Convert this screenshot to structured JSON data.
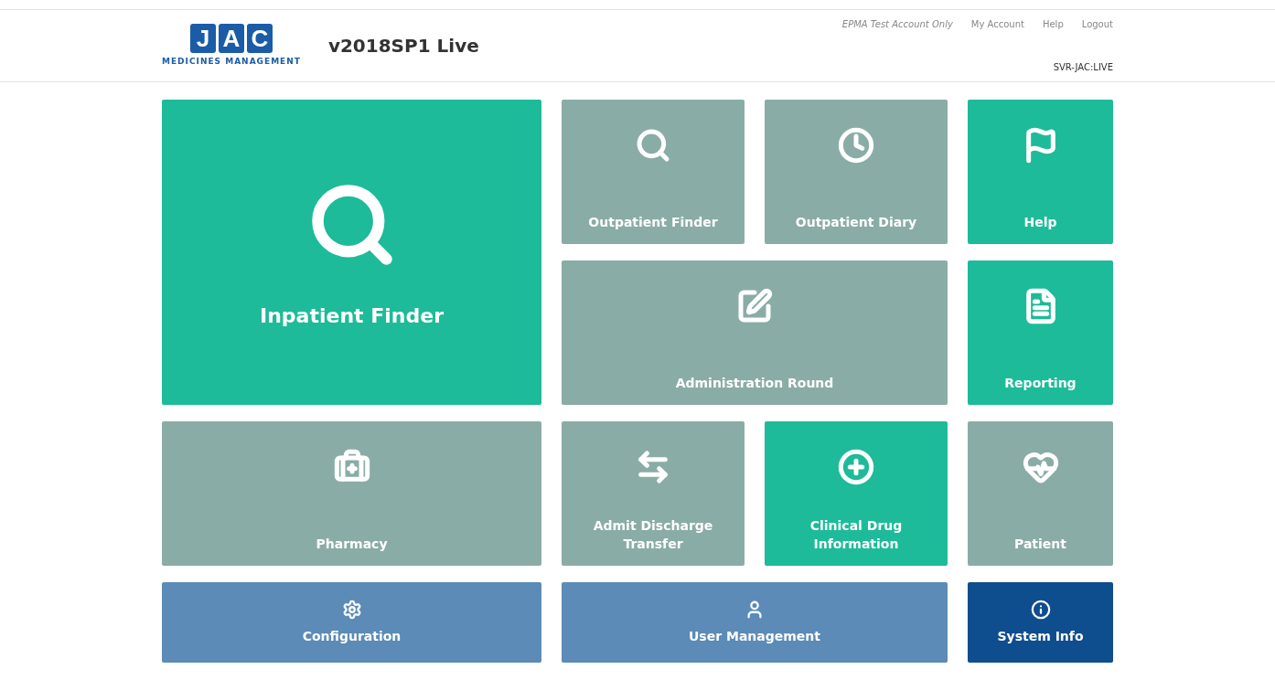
{
  "header": {
    "logo_letters": [
      "J",
      "A",
      "C"
    ],
    "logo_tagline": "MEDICINES MANAGEMENT",
    "version": "v2018SP1 Live",
    "account_note": "EPMA Test Account Only",
    "links": [
      "My Account",
      "Help",
      "Logout"
    ],
    "server": "SVR-JAC:LIVE"
  },
  "tiles": [
    {
      "label": "Inpatient Finder",
      "kind": "active"
    },
    {
      "label": "Outpatient Finder",
      "kind": "inactive"
    },
    {
      "label": "Outpatient Diary",
      "kind": "inactive"
    },
    {
      "label": "Help",
      "kind": "active"
    },
    {
      "label": "Administration Round",
      "kind": "inactive"
    },
    {
      "label": "Reporting",
      "kind": "active"
    },
    {
      "label": "Pharmacy",
      "kind": "inactive"
    },
    {
      "label": "Admit Discharge Transfer",
      "kind": "inactive"
    },
    {
      "label": "Clinical Drug Information",
      "kind": "active"
    },
    {
      "label": "Patient",
      "kind": "inactive"
    },
    {
      "label": "Configuration",
      "kind": "admin"
    },
    {
      "label": "User Management",
      "kind": "admin"
    },
    {
      "label": "System Info",
      "kind": "info"
    }
  ]
}
